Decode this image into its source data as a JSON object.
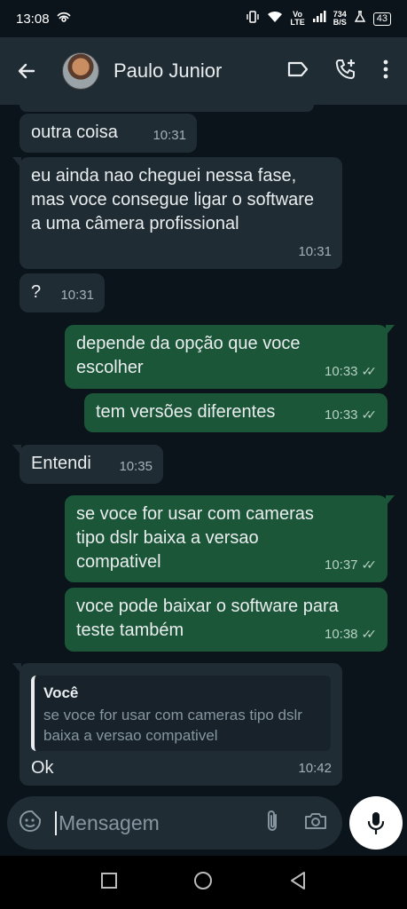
{
  "status_bar": {
    "time": "13:08",
    "network_speed_value": "734",
    "network_speed_unit": "B/S",
    "volte_top": "Vo",
    "volte_bottom": "LTE",
    "battery": "43"
  },
  "header": {
    "contact_name": "Paulo Junior"
  },
  "messages": [
    {
      "direction": "in",
      "text": "outra coisa",
      "time": "10:31"
    },
    {
      "direction": "in",
      "text": "eu ainda nao cheguei nessa fase, mas voce consegue ligar o software a uma câmera profissional",
      "time": "10:31"
    },
    {
      "direction": "in",
      "text": "?",
      "time": "10:31"
    },
    {
      "direction": "out",
      "text": "depende da opção que voce escolher",
      "time": "10:33"
    },
    {
      "direction": "out",
      "text": "tem versões diferentes",
      "time": "10:33"
    },
    {
      "direction": "in",
      "text": "Entendi",
      "time": "10:35"
    },
    {
      "direction": "out",
      "text": "se voce for usar com cameras tipo dslr baixa a versao compativel",
      "time": "10:37"
    },
    {
      "direction": "out",
      "text": "voce pode baixar o software para teste também",
      "time": "10:38"
    },
    {
      "direction": "in",
      "text": "Ok",
      "time": "10:42",
      "quote_author": "Você",
      "quote_text": "se voce for usar com cameras tipo dslr baixa a versao compativel"
    }
  ],
  "composer": {
    "placeholder": "Mensagem"
  },
  "colors": {
    "background": "#0b141a",
    "incoming_bubble": "#202c33",
    "outgoing_bubble": "#1c5638",
    "header": "#1f2c34"
  }
}
